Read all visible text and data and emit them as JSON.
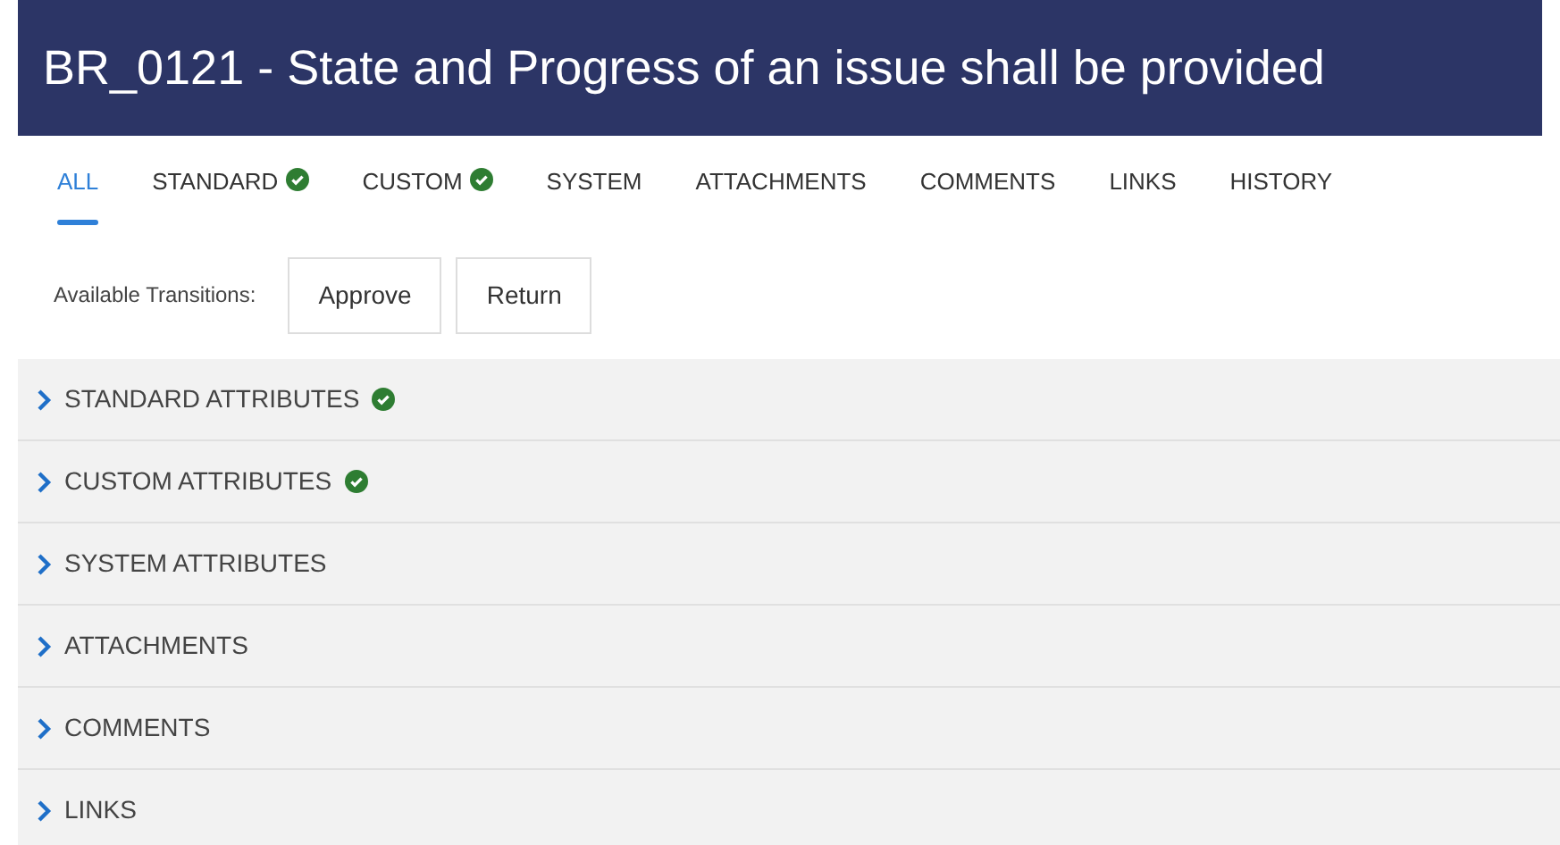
{
  "header": {
    "title": "BR_0121 - State and Progress of an issue shall be provided"
  },
  "tabs": [
    {
      "label": "ALL",
      "selected": true,
      "complete": false
    },
    {
      "label": "STANDARD",
      "selected": false,
      "complete": true
    },
    {
      "label": "CUSTOM",
      "selected": false,
      "complete": true
    },
    {
      "label": "SYSTEM",
      "selected": false,
      "complete": false
    },
    {
      "label": "ATTACHMENTS",
      "selected": false,
      "complete": false
    },
    {
      "label": "COMMENTS",
      "selected": false,
      "complete": false
    },
    {
      "label": "LINKS",
      "selected": false,
      "complete": false
    },
    {
      "label": "HISTORY",
      "selected": false,
      "complete": false
    }
  ],
  "transitions": {
    "label": "Available Transitions:",
    "buttons": [
      "Approve",
      "Return"
    ]
  },
  "sections": [
    {
      "title": "STANDARD ATTRIBUTES",
      "complete": true,
      "expanded": false
    },
    {
      "title": "CUSTOM ATTRIBUTES",
      "complete": true,
      "expanded": false
    },
    {
      "title": "SYSTEM ATTRIBUTES",
      "complete": false,
      "expanded": false
    },
    {
      "title": "ATTACHMENTS",
      "complete": false,
      "expanded": false
    },
    {
      "title": "COMMENTS",
      "complete": false,
      "expanded": false
    },
    {
      "title": "LINKS",
      "complete": false,
      "expanded": false
    }
  ]
}
